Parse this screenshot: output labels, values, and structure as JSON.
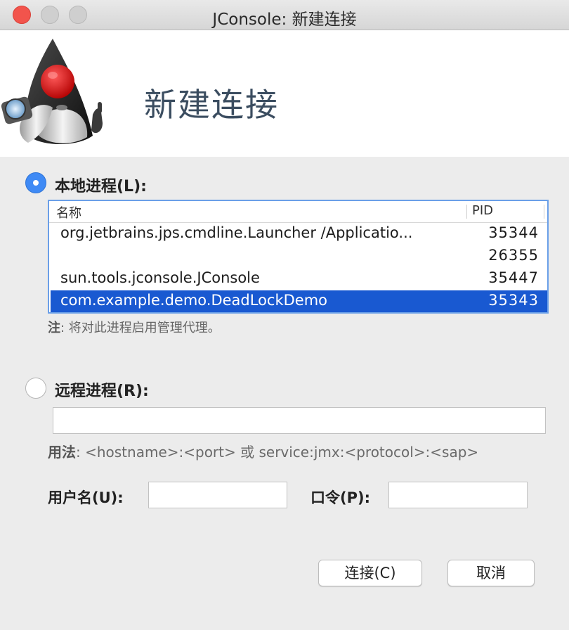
{
  "window": {
    "title": "JConsole: 新建连接"
  },
  "banner": {
    "heading": "新建连接",
    "logo_icon": "duke-mascot-icon"
  },
  "local": {
    "radio_label": "本地进程(L):",
    "selected": true,
    "columns": {
      "name": "名称",
      "pid": "PID"
    },
    "rows": [
      {
        "name": "org.jetbrains.jps.cmdline.Launcher /Applicatio...",
        "pid": "35344"
      },
      {
        "name": "",
        "pid": "26355"
      },
      {
        "name": "sun.tools.jconsole.JConsole",
        "pid": "35447"
      },
      {
        "name": "com.example.demo.DeadLockDemo",
        "pid": "35343"
      }
    ],
    "selected_row": 3,
    "note_prefix": "注",
    "note_text": ": 将对此进程启用管理代理。"
  },
  "remote": {
    "radio_label": "远程进程(R):",
    "selected": false,
    "address_value": "",
    "usage_prefix": "用法",
    "usage_text": ": <hostname>:<port> 或 service:jmx:<protocol>:<sap>"
  },
  "credentials": {
    "username_label": "用户名(U):",
    "username_value": "",
    "password_label": "口令(P):",
    "password_value": ""
  },
  "buttons": {
    "connect": "连接(C)",
    "cancel": "取消"
  },
  "colors": {
    "selection": "#1959d1",
    "radio_accent": "#3f8af5",
    "close": "#f2544c"
  }
}
